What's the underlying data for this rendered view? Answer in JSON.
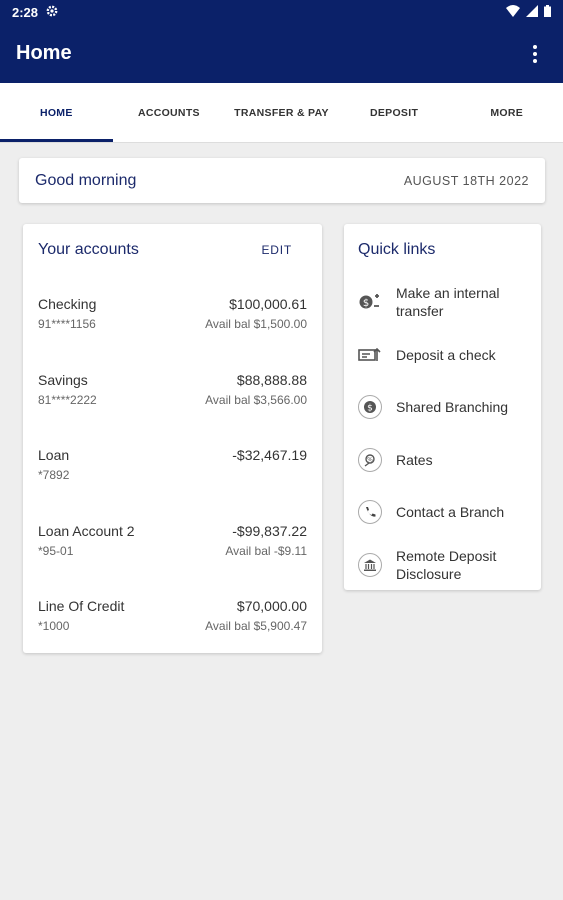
{
  "status": {
    "time": "2:28"
  },
  "appbar": {
    "title": "Home"
  },
  "tabs": [
    "HOME",
    "ACCOUNTS",
    "TRANSFER & PAY",
    "DEPOSIT",
    "MORE"
  ],
  "greeting": {
    "text": "Good morning",
    "date": "AUGUST 18TH 2022"
  },
  "accounts": {
    "title": "Your accounts",
    "edit": "EDIT",
    "items": [
      {
        "name": "Checking",
        "number": "91****1156",
        "amount": "$100,000.61",
        "avail": "Avail bal $1,500.00"
      },
      {
        "name": "Savings",
        "number": "81****2222",
        "amount": "$88,888.88",
        "avail": "Avail bal $3,566.00"
      },
      {
        "name": "Loan",
        "number": "*7892",
        "amount": "-$32,467.19",
        "avail": ""
      },
      {
        "name": "Loan Account 2",
        "number": "*95-01",
        "amount": "-$99,837.22",
        "avail": "Avail bal -$9.11"
      },
      {
        "name": "Line Of Credit",
        "number": "*1000",
        "amount": "$70,000.00",
        "avail": "Avail bal $5,900.47"
      }
    ]
  },
  "quicklinks": {
    "title": "Quick links",
    "items": [
      {
        "label": "Make an internal transfer",
        "icon": "transfer-icon"
      },
      {
        "label": "Deposit a check",
        "icon": "check-icon"
      },
      {
        "label": "Shared Branching",
        "icon": "branch-icon"
      },
      {
        "label": "Rates",
        "icon": "rates-icon"
      },
      {
        "label": "Contact a Branch",
        "icon": "phone-icon"
      },
      {
        "label": "Remote Deposit Disclosure",
        "icon": "bank-icon"
      }
    ]
  },
  "colors": {
    "primary": "#0b2169",
    "background": "#eeeeee"
  }
}
